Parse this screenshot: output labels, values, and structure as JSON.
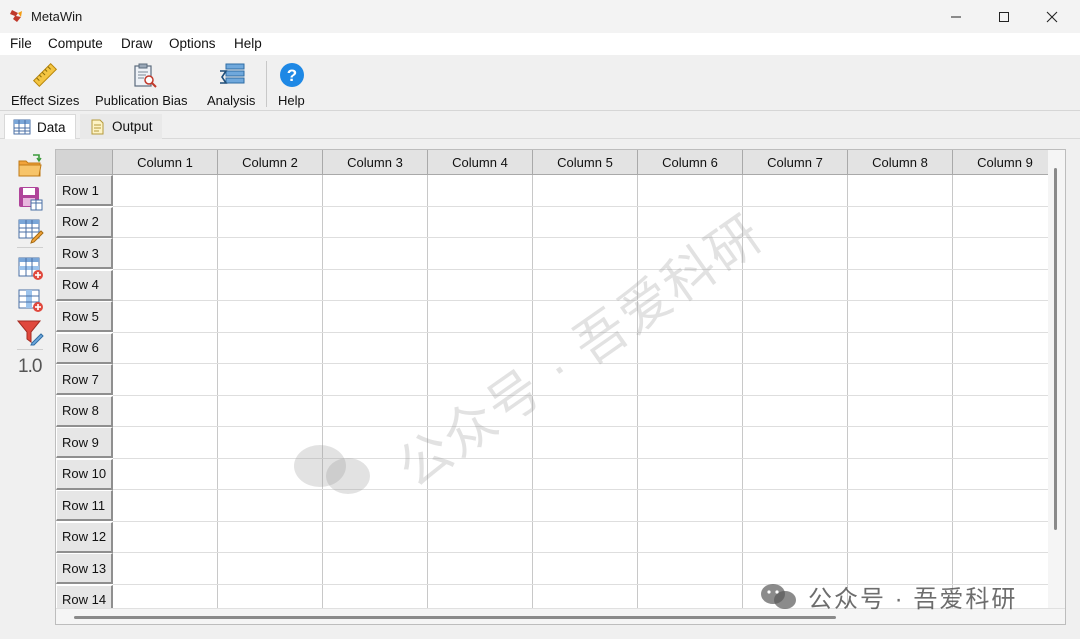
{
  "window": {
    "title": "MetaWin",
    "minimize_icon": "minimize-icon",
    "maximize_icon": "maximize-icon",
    "close_icon": "close-icon"
  },
  "menu": [
    "File",
    "Compute",
    "Draw",
    "Options",
    "Help"
  ],
  "toolbar": {
    "effect_sizes": {
      "label": "Effect Sizes",
      "icon": "ruler-icon"
    },
    "publication_bias": {
      "label": "Publication Bias",
      "icon": "clipboard-search-icon"
    },
    "analysis": {
      "label": "Analysis",
      "icon": "sigma-stack-icon"
    },
    "help": {
      "label": "Help",
      "icon": "help-icon"
    }
  },
  "tabs": {
    "data": "Data",
    "output": "Output"
  },
  "sidebar": {
    "tools": [
      "open-folder-icon",
      "save-table-icon",
      "edit-table-icon",
      "add-row-icon",
      "add-column-icon",
      "filter-edit-icon"
    ],
    "decimal_label": "1.0"
  },
  "grid": {
    "columns": [
      "Column 1",
      "Column 2",
      "Column 3",
      "Column 4",
      "Column 5",
      "Column 6",
      "Column 7",
      "Column 8",
      "Column 9"
    ],
    "rows": [
      "Row 1",
      "Row 2",
      "Row 3",
      "Row 4",
      "Row 5",
      "Row 6",
      "Row 7",
      "Row 8",
      "Row 9",
      "Row 10",
      "Row 11",
      "Row 12",
      "Row 13",
      "Row 14"
    ]
  },
  "watermark": {
    "diagonal_text": "公众号 · 吾爱科研",
    "footer_text": "公众号 · 吾爱科研",
    "icon": "wechat-icon"
  },
  "colors": {
    "help_blue": "#1e88e5",
    "folder_orange": "#f2a33a",
    "save_purple": "#b0459b",
    "filter_red": "#e0483d"
  }
}
